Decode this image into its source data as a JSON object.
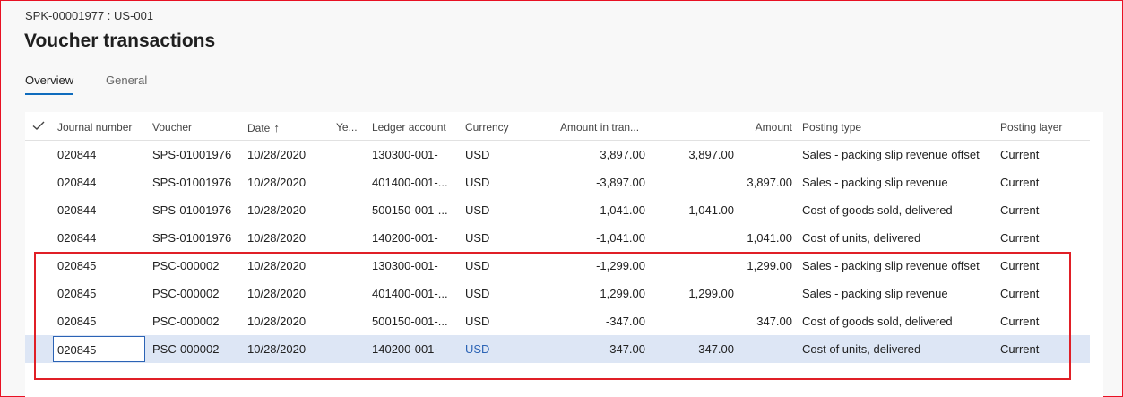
{
  "header": {
    "breadcrumb": "SPK-00001977 : US-001",
    "title": "Voucher transactions"
  },
  "tabs": [
    {
      "label": "Overview",
      "active": true
    },
    {
      "label": "General",
      "active": false
    }
  ],
  "grid": {
    "columns": {
      "journal_number": "Journal number",
      "voucher": "Voucher",
      "date": "Date",
      "year": "Ye...",
      "ledger_account": "Ledger account",
      "currency": "Currency",
      "amount_in_transaction_currency": "Amount in tran...",
      "amount": "Amount",
      "posting_type": "Posting type",
      "posting_layer": "Posting layer"
    },
    "sort": {
      "column": "Date",
      "direction": "ascending"
    },
    "rows": [
      {
        "journal": "020844",
        "voucher": "SPS-01001976",
        "date": "10/28/2020",
        "ledger": "130300-001-",
        "currency": "USD",
        "amount_tran": "3,897.00",
        "debit": "3,897.00",
        "credit": "",
        "posting_type": "Sales - packing slip revenue offset",
        "layer": "Current"
      },
      {
        "journal": "020844",
        "voucher": "SPS-01001976",
        "date": "10/28/2020",
        "ledger": "401400-001-...",
        "currency": "USD",
        "amount_tran": "-3,897.00",
        "debit": "",
        "credit": "3,897.00",
        "posting_type": "Sales - packing slip revenue",
        "layer": "Current"
      },
      {
        "journal": "020844",
        "voucher": "SPS-01001976",
        "date": "10/28/2020",
        "ledger": "500150-001-...",
        "currency": "USD",
        "amount_tran": "1,041.00",
        "debit": "1,041.00",
        "credit": "",
        "posting_type": "Cost of goods sold, delivered",
        "layer": "Current"
      },
      {
        "journal": "020844",
        "voucher": "SPS-01001976",
        "date": "10/28/2020",
        "ledger": "140200-001-",
        "currency": "USD",
        "amount_tran": "-1,041.00",
        "debit": "",
        "credit": "1,041.00",
        "posting_type": "Cost of units, delivered",
        "layer": "Current"
      },
      {
        "journal": "020845",
        "voucher": "PSC-000002",
        "date": "10/28/2020",
        "ledger": "130300-001-",
        "currency": "USD",
        "amount_tran": "-1,299.00",
        "debit": "",
        "credit": "1,299.00",
        "posting_type": "Sales - packing slip revenue offset",
        "layer": "Current"
      },
      {
        "journal": "020845",
        "voucher": "PSC-000002",
        "date": "10/28/2020",
        "ledger": "401400-001-...",
        "currency": "USD",
        "amount_tran": "1,299.00",
        "debit": "1,299.00",
        "credit": "",
        "posting_type": "Sales - packing slip revenue",
        "layer": "Current"
      },
      {
        "journal": "020845",
        "voucher": "PSC-000002",
        "date": "10/28/2020",
        "ledger": "500150-001-...",
        "currency": "USD",
        "amount_tran": "-347.00",
        "debit": "",
        "credit": "347.00",
        "posting_type": "Cost of goods sold, delivered",
        "layer": "Current"
      },
      {
        "journal": "020845",
        "voucher": "PSC-000002",
        "date": "10/28/2020",
        "ledger": "140200-001-",
        "currency": "USD",
        "amount_tran": "347.00",
        "debit": "347.00",
        "credit": "",
        "posting_type": "Cost of units, delivered",
        "layer": "Current",
        "selected": true
      }
    ]
  },
  "colors": {
    "highlight_box": "#e01f26",
    "selected_row": "#dde6f5",
    "accent": "#0f6cbd",
    "link": "#2b63b5"
  }
}
